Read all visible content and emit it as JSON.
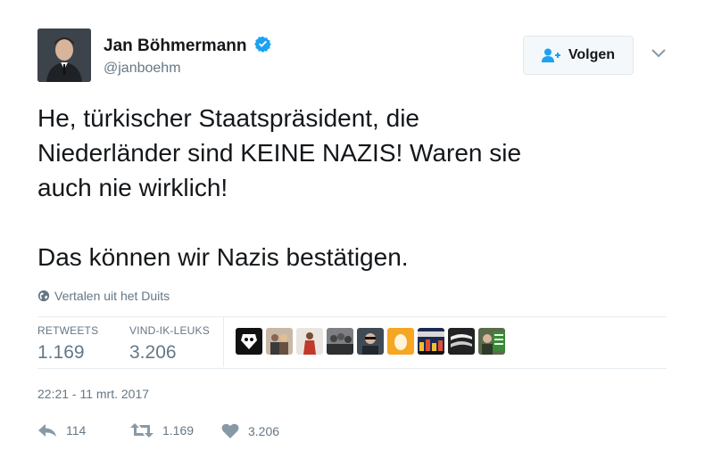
{
  "user": {
    "name": "Jan Böhmermann",
    "handle": "@janboehm",
    "verified": true
  },
  "follow_button": {
    "label": "Volgen"
  },
  "tweet": {
    "text": "He, türkischer Staatspräsident, die\nNiederländer sind KEINE NAZIS! Waren sie\nauch nie wirklich!\n\nDas können wir Nazis bestätigen.",
    "translate_label": "Vertalen uit het Duits",
    "timestamp": "22:21 - 11 mrt. 2017"
  },
  "stats": {
    "retweets_label": "RETWEETS",
    "retweets_value": "1.169",
    "likes_label": "VIND-IK-LEUKS",
    "likes_value": "3.206"
  },
  "likers": [
    {
      "icon": "skull-logo-avatar"
    },
    {
      "icon": "couple-photo-avatar"
    },
    {
      "icon": "woman-red-dress-avatar"
    },
    {
      "icon": "crowd-photo-avatar"
    },
    {
      "icon": "man-sunglasses-avatar"
    },
    {
      "icon": "egg-default-avatar"
    },
    {
      "icon": "city-skyline-avatar"
    },
    {
      "icon": "hands-bw-avatar"
    },
    {
      "icon": "free-green-avatar"
    }
  ],
  "actions": {
    "reply_count": "114",
    "retweet_count": "1.169",
    "like_count": "3.206"
  },
  "colors": {
    "verified_blue": "#1da1f2",
    "muted": "#657786",
    "follow_icon": "#1da1f2",
    "egg_orange": "#f5a623"
  }
}
